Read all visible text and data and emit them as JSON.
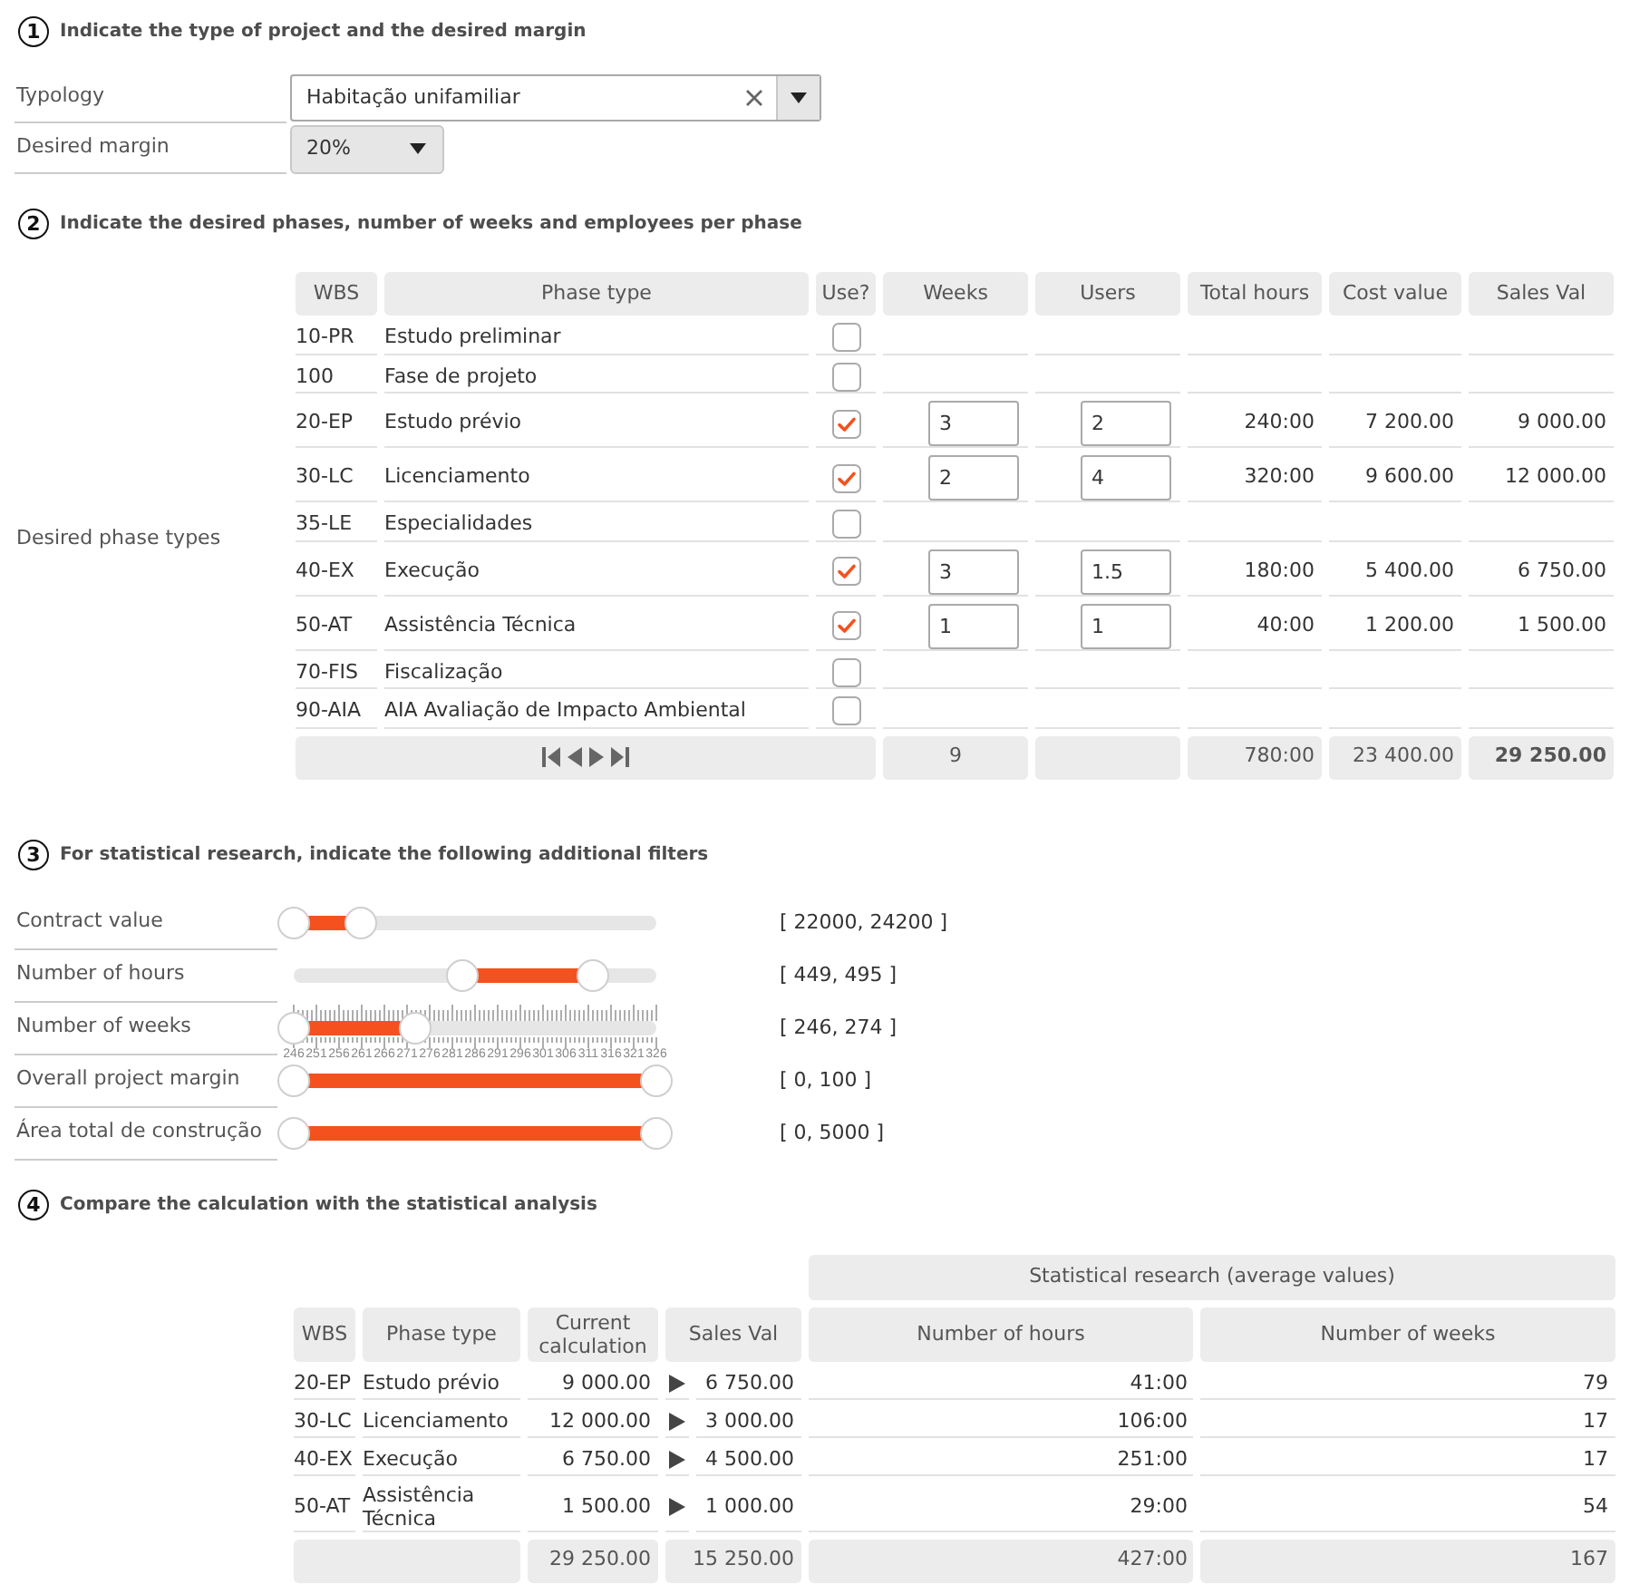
{
  "step1": {
    "number": "1",
    "title": "Indicate the type of project and the desired margin",
    "fields": [
      {
        "kind": "combobox",
        "label": "Typology",
        "value": "Habitação unifamiliar"
      },
      {
        "kind": "dropdown",
        "label": "Desired margin",
        "value": "20%"
      }
    ]
  },
  "step2": {
    "number": "2",
    "title": "Indicate the desired phases, number of weeks and employees per phase",
    "label": "Desired phase types",
    "columns": [
      "WBS",
      "Phase type",
      "Use?",
      "Weeks",
      "Users",
      "Total hours",
      "Cost value",
      "Sales Val"
    ],
    "rows": [
      {
        "wbs": "10-PR",
        "phase": "Estudo preliminar",
        "checked": false
      },
      {
        "wbs": "100",
        "phase": "Fase de projeto",
        "checked": false
      },
      {
        "wbs": "20-EP",
        "phase": "Estudo prévio",
        "checked": true,
        "weeks": "3",
        "users": "2",
        "total_hours": "240:00",
        "cost_value": "7 200.00",
        "sales_val": "9 000.00"
      },
      {
        "wbs": "30-LC",
        "phase": "Licenciamento",
        "checked": true,
        "weeks": "2",
        "users": "4",
        "total_hours": "320:00",
        "cost_value": "9 600.00",
        "sales_val": "12 000.00"
      },
      {
        "wbs": "35-LE",
        "phase": "Especialidades",
        "checked": false
      },
      {
        "wbs": "40-EX",
        "phase": "Execução",
        "checked": true,
        "weeks": "3",
        "users": "1.5",
        "total_hours": "180:00",
        "cost_value": "5 400.00",
        "sales_val": "6 750.00"
      },
      {
        "wbs": "50-AT",
        "phase": "Assistência Técnica",
        "checked": true,
        "weeks": "1",
        "users": "1",
        "total_hours": "40:00",
        "cost_value": "1 200.00",
        "sales_val": "1 500.00"
      },
      {
        "wbs": "70-FIS",
        "phase": "Fiscalização",
        "checked": false
      },
      {
        "wbs": "90-AIA",
        "phase": "AIA Avaliação de Impacto Ambiental",
        "checked": false
      }
    ],
    "totals": {
      "weeks": "9",
      "total_hours": "780:00",
      "cost_value": "23 400.00",
      "sales_val": "29 250.00"
    }
  },
  "step3": {
    "number": "3",
    "title": "For statistical research, indicate the following additional filters",
    "sliders": [
      {
        "label": "Contract value",
        "handles": [
          {
            "level": 0
          },
          {
            "level": 0.185
          }
        ],
        "reading": "[ 22000, 24200 ]"
      },
      {
        "label": "Number of hours",
        "handles": [
          {
            "level": 0.465
          },
          {
            "level": 0.825
          }
        ],
        "reading": "[ 449, 495 ]"
      },
      {
        "label": "Number of weeks",
        "handles": [
          {
            "level": 0
          },
          {
            "level": 0.335
          }
        ],
        "reading": "[ 246, 274 ]",
        "tick_labels": [
          "246",
          "251",
          "256",
          "261",
          "266",
          "271",
          "276",
          "281",
          "286",
          "291",
          "296",
          "301",
          "306",
          "311",
          "316",
          "321",
          "326"
        ]
      },
      {
        "label": "Overall project margin",
        "handles": [
          {
            "level": 0
          },
          {
            "level": 1
          }
        ],
        "reading": "[ 0, 100 ]"
      },
      {
        "label": "Área total de construção",
        "handles": [
          {
            "level": 0
          },
          {
            "level": 1
          }
        ],
        "reading": "[ 0, 5000 ]"
      }
    ]
  },
  "step4": {
    "number": "4",
    "title": "Compare the calculation with the statistical analysis",
    "group_header": "Statistical research (average values)",
    "columns": [
      "WBS",
      "Phase type",
      "Current calculation",
      "Sales Val",
      "Number of hours",
      "Number of weeks"
    ],
    "rows": [
      {
        "wbs": "20-EP",
        "phase": "Estudo prévio",
        "current": "9 000.00",
        "sales_val": "6 750.00",
        "hours": "41:00",
        "weeks": "79"
      },
      {
        "wbs": "30-LC",
        "phase": "Licenciamento",
        "current": "12 000.00",
        "sales_val": "3 000.00",
        "hours": "106:00",
        "weeks": "17"
      },
      {
        "wbs": "40-EX",
        "phase": "Execução",
        "current": "6 750.00",
        "sales_val": "4 500.00",
        "hours": "251:00",
        "weeks": "17"
      },
      {
        "wbs": "50-AT",
        "phase": "Assistência Técnica",
        "current": "1 500.00",
        "sales_val": "1 000.00",
        "hours": "29:00",
        "weeks": "54"
      }
    ],
    "totals": {
      "current": "29 250.00",
      "sales_val": "15 250.00",
      "hours": "427:00",
      "weeks": "167"
    }
  }
}
